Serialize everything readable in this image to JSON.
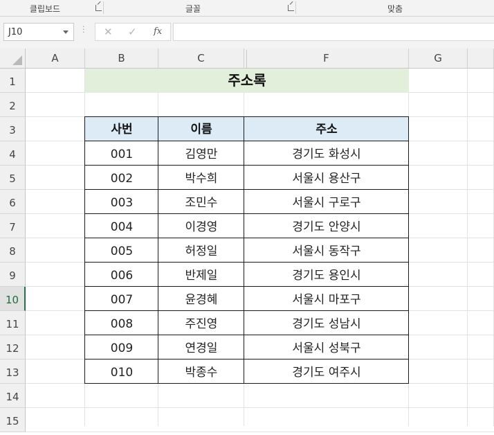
{
  "ribbon": {
    "groups": [
      {
        "label": "클립보드"
      },
      {
        "label": "글꼴"
      },
      {
        "label": "맞춤"
      }
    ]
  },
  "formula_bar": {
    "name_box": "J10",
    "cancel_icon": "✕",
    "enter_icon": "✓",
    "fx_label": "fx",
    "formula": ""
  },
  "columns": [
    "A",
    "B",
    "C",
    "F",
    "G"
  ],
  "rows": [
    "1",
    "2",
    "3",
    "4",
    "5",
    "6",
    "7",
    "8",
    "9",
    "10",
    "11",
    "12",
    "13",
    "14",
    "15"
  ],
  "active_row": "10",
  "sheet": {
    "title": "주소록",
    "headers": [
      "사번",
      "이름",
      "주소"
    ],
    "records": [
      [
        "001",
        "김영만",
        "경기도 화성시"
      ],
      [
        "002",
        "박수희",
        "서울시 용산구"
      ],
      [
        "003",
        "조민수",
        "서울시 구로구"
      ],
      [
        "004",
        "이경영",
        "경기도 안양시"
      ],
      [
        "005",
        "허정일",
        "서울시 동작구"
      ],
      [
        "006",
        "반제일",
        "경기도 용인시"
      ],
      [
        "007",
        "윤경혜",
        "서울시 마포구"
      ],
      [
        "008",
        "주진영",
        "경기도 성남시"
      ],
      [
        "009",
        "연경일",
        "서울시 성북구"
      ],
      [
        "010",
        "박종수",
        "경기도 여주시"
      ]
    ]
  },
  "colors": {
    "title_fill": "#e2efda",
    "header_fill": "#ddebf7",
    "active_accent": "#217346"
  }
}
